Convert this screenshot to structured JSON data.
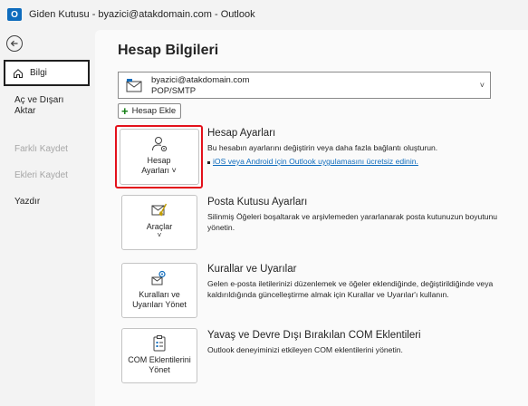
{
  "window": {
    "title": "Giden Kutusu - byazici@atakdomain.com - Outlook",
    "app_icon_letter": "O"
  },
  "sidebar": {
    "items": [
      {
        "label": "Bilgi",
        "state": "active"
      },
      {
        "label": "Aç ve Dışarı\nAktar",
        "state": "enabled"
      },
      {
        "label": "Farklı Kaydet",
        "state": "disabled"
      },
      {
        "label": "Ekleri Kaydet",
        "state": "disabled"
      },
      {
        "label": "Yazdır",
        "state": "enabled"
      }
    ]
  },
  "main": {
    "title": "Hesap Bilgileri",
    "account": {
      "email": "byazici@atakdomain.com",
      "type": "POP/SMTP"
    },
    "add_account_label": "Hesap Ekle",
    "sections": [
      {
        "tile_label": "Hesap\nAyarları ˅",
        "title": "Hesap Ayarları",
        "description": "Bu hesabın ayarlarını değiştirin veya daha fazla bağlantı oluşturun.",
        "link": "iOS veya Android için Outlook uygulamasını ücretsiz edinin."
      },
      {
        "tile_label": "Araçlar",
        "title": "Posta Kutusu Ayarları",
        "description": "Silinmiş Öğeleri boşaltarak ve arşivlemeden yararlanarak posta kutunuzun boyutunu yönetin."
      },
      {
        "tile_label": "Kuralları ve\nUyarıları Yönet",
        "title": "Kurallar ve Uyarılar",
        "description": "Gelen e-posta iletilerinizi düzenlemek ve öğeler eklendiğinde, değiştirildiğinde veya kaldırıldığında güncelleştirme almak için Kurallar ve Uyarılar'ı kullanın."
      },
      {
        "tile_label": "COM Eklentilerini\nYönet",
        "title": "Yavaş ve Devre Dışı Bırakılan COM Eklentileri",
        "description": "Outlook deneyiminizi etkileyen COM eklentilerini yönetin."
      }
    ]
  },
  "colors": {
    "accent": "#0f6cbd",
    "selection_outline": "#e3111b",
    "link": "#0f6cbd"
  },
  "icons": {
    "back": "back-arrow-icon",
    "info": "home-icon",
    "account_settings": "person-gear-icon",
    "tools": "mailbox-broom-icon",
    "rules": "envelope-gear-icon",
    "com_addins": "clipboard-icon",
    "add": "plus-icon",
    "dropdown": "chevron-down-icon"
  }
}
